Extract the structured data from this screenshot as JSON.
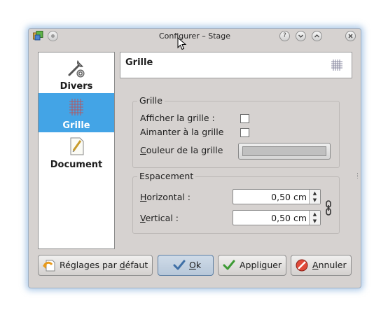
{
  "window": {
    "title": "Configurer – Stage"
  },
  "sidebar": {
    "items": [
      {
        "label": "Divers",
        "icon": "tools-icon"
      },
      {
        "label": "Grille",
        "icon": "grid-icon",
        "active": true
      },
      {
        "label": "Document",
        "icon": "document-pen-icon"
      }
    ]
  },
  "header": {
    "title": "Grille",
    "icon": "grid-icon"
  },
  "grid_group": {
    "title": "Grille",
    "show_grid_label": "Afficher la grille :",
    "show_grid_checked": false,
    "snap_grid_label": "Aimanter à la grille",
    "snap_grid_checked": false,
    "color_label_u": "C",
    "color_label_rest": "ouleur de la grille",
    "color_value": "#c0c0c0"
  },
  "spacing_group": {
    "title": "Espacement",
    "horizontal_label_u": "H",
    "horizontal_label_rest": "orizontal :",
    "horizontal_value": "0,50 cm",
    "vertical_label_u": "V",
    "vertical_label_rest": "ertical :",
    "vertical_value": "0,50 cm",
    "link_icon": "chain-link-icon"
  },
  "buttons": {
    "defaults_a": "Réglages par ",
    "defaults_u": "d",
    "defaults_b": "éfaut",
    "ok_u": "O",
    "ok_rest": "k",
    "apply_a": "Appli",
    "apply_u": "q",
    "apply_b": "uer",
    "cancel_u": "A",
    "cancel_rest": "nnuler"
  },
  "colors": {
    "selection": "#43a4e6",
    "window_bg": "#d6d2d0",
    "glow": "#6ea0d7"
  }
}
